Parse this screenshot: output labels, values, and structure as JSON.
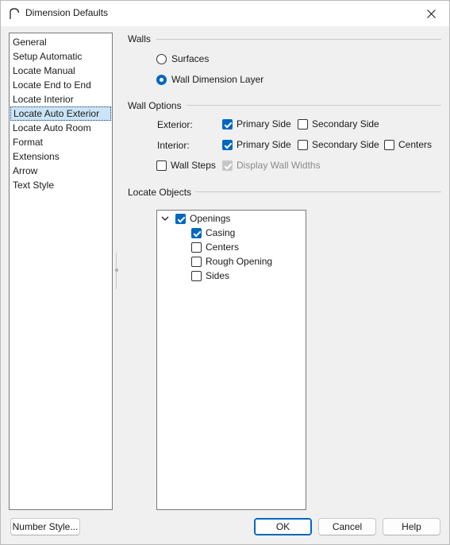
{
  "window": {
    "title": "Dimension Defaults"
  },
  "sidebar": {
    "items": [
      {
        "label": "General"
      },
      {
        "label": "Setup Automatic"
      },
      {
        "label": "Locate Manual"
      },
      {
        "label": "Locate End to End"
      },
      {
        "label": "Locate Interior"
      },
      {
        "label": "Locate Auto Exterior",
        "selected": true
      },
      {
        "label": "Locate Auto Room"
      },
      {
        "label": "Format"
      },
      {
        "label": "Extensions"
      },
      {
        "label": "Arrow"
      },
      {
        "label": "Text Style"
      }
    ]
  },
  "walls": {
    "header": "Walls",
    "surfaces": {
      "label": "Surfaces",
      "selected": false
    },
    "wall_dimension_layer": {
      "label": "Wall Dimension Layer",
      "selected": true
    }
  },
  "wall_options": {
    "header": "Wall Options",
    "exterior": {
      "label": "Exterior:",
      "primary_side": {
        "label": "Primary Side",
        "checked": true
      },
      "secondary_side": {
        "label": "Secondary Side",
        "checked": false
      }
    },
    "interior": {
      "label": "Interior:",
      "primary_side": {
        "label": "Primary Side",
        "checked": true
      },
      "secondary_side": {
        "label": "Secondary Side",
        "checked": false
      },
      "centers": {
        "label": "Centers",
        "checked": false
      }
    },
    "wall_steps": {
      "label": "Wall Steps",
      "checked": false
    },
    "display_wall_widths": {
      "label": "Display Wall Widths",
      "checked": true,
      "disabled": true
    }
  },
  "locate_objects": {
    "header": "Locate Objects",
    "tree": {
      "openings": {
        "label": "Openings",
        "checked": true,
        "expanded": true
      },
      "children": [
        {
          "label": "Casing",
          "checked": true
        },
        {
          "label": "Centers",
          "checked": false
        },
        {
          "label": "Rough Opening",
          "checked": false
        },
        {
          "label": "Sides",
          "checked": false
        }
      ]
    }
  },
  "buttons": {
    "number_style": "Number Style...",
    "ok": "OK",
    "cancel": "Cancel",
    "help": "Help"
  },
  "colors": {
    "accent": "#0067c0",
    "selection": "#cce4f7"
  }
}
